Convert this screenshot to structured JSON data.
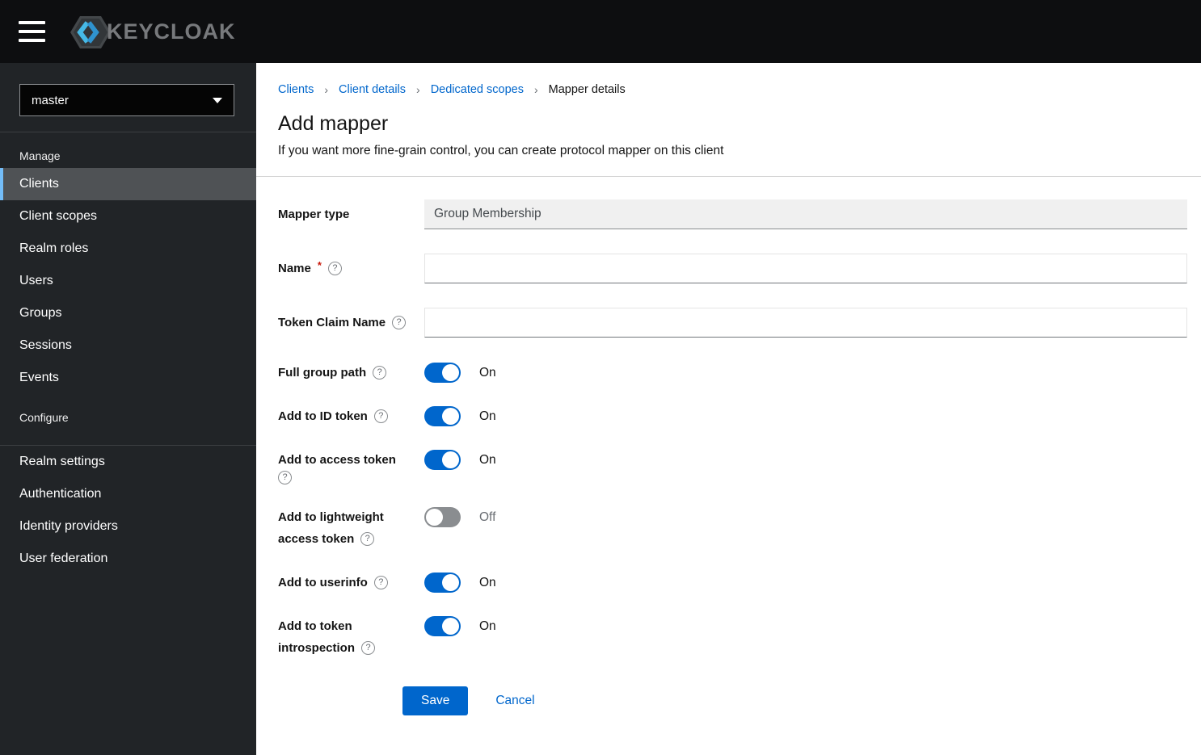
{
  "masthead": {
    "brand_text": "KEYCLOAK"
  },
  "sidebar": {
    "realm_selector": {
      "value": "master"
    },
    "sections": [
      {
        "label": "Manage",
        "divider_position": "above-label",
        "items": [
          {
            "label": "Clients",
            "selected": true
          },
          {
            "label": "Client scopes",
            "selected": false
          },
          {
            "label": "Realm roles",
            "selected": false
          },
          {
            "label": "Users",
            "selected": false
          },
          {
            "label": "Groups",
            "selected": false
          },
          {
            "label": "Sessions",
            "selected": false
          },
          {
            "label": "Events",
            "selected": false
          }
        ]
      },
      {
        "label": "Configure",
        "divider_position": "below-label",
        "items": [
          {
            "label": "Realm settings",
            "selected": false
          },
          {
            "label": "Authentication",
            "selected": false
          },
          {
            "label": "Identity providers",
            "selected": false
          },
          {
            "label": "User federation",
            "selected": false
          }
        ]
      }
    ]
  },
  "breadcrumb": {
    "separator": "›",
    "items": [
      {
        "label": "Clients",
        "link": true
      },
      {
        "label": "Client details",
        "link": true
      },
      {
        "label": "Dedicated scopes",
        "link": true
      },
      {
        "label": "Mapper details",
        "link": false
      }
    ]
  },
  "page": {
    "title": "Add mapper",
    "subtitle": "If you want more fine-grain control, you can create protocol mapper on this client"
  },
  "form": {
    "required_marker": "*",
    "help_icon_glyph": "?",
    "fields": [
      {
        "label": "Mapper type",
        "label_lines": [
          "Mapper type"
        ],
        "required": false,
        "help": false,
        "help_on_new_line": false,
        "control": {
          "type": "readonly",
          "value": "Group Membership"
        }
      },
      {
        "label": "Name",
        "label_lines": [
          "Name"
        ],
        "required": true,
        "help": true,
        "help_on_new_line": false,
        "control": {
          "type": "text",
          "value": "",
          "placeholder": ""
        }
      },
      {
        "label": "Token Claim Name",
        "label_lines": [
          "Token Claim Name"
        ],
        "required": false,
        "help": true,
        "help_on_new_line": false,
        "control": {
          "type": "text",
          "value": "",
          "placeholder": ""
        }
      },
      {
        "label": "Full group path",
        "label_lines": [
          "Full group path"
        ],
        "required": false,
        "help": true,
        "help_on_new_line": false,
        "control": {
          "type": "toggle",
          "on": true,
          "state_label": "On"
        }
      },
      {
        "label": "Add to ID token",
        "label_lines": [
          "Add to ID token"
        ],
        "required": false,
        "help": true,
        "help_on_new_line": false,
        "control": {
          "type": "toggle",
          "on": true,
          "state_label": "On"
        }
      },
      {
        "label": "Add to access token",
        "label_lines": [
          "Add to access token"
        ],
        "required": false,
        "help": true,
        "help_on_new_line": true,
        "control": {
          "type": "toggle",
          "on": true,
          "state_label": "On"
        }
      },
      {
        "label": "Add to lightweight access token",
        "label_lines": [
          "Add to lightweight",
          "access token"
        ],
        "required": false,
        "help": true,
        "help_on_new_line": false,
        "control": {
          "type": "toggle",
          "on": false,
          "state_label": "Off"
        }
      },
      {
        "label": "Add to userinfo",
        "label_lines": [
          "Add to userinfo"
        ],
        "required": false,
        "help": true,
        "help_on_new_line": false,
        "control": {
          "type": "toggle",
          "on": true,
          "state_label": "On"
        }
      },
      {
        "label": "Add to token introspection",
        "label_lines": [
          "Add to token",
          "introspection"
        ],
        "required": false,
        "help": true,
        "help_on_new_line": false,
        "control": {
          "type": "toggle",
          "on": true,
          "state_label": "On"
        }
      }
    ],
    "actions": {
      "save": "Save",
      "cancel": "Cancel"
    }
  },
  "colors": {
    "masthead_bg": "#0d0e10",
    "sidebar_bg": "#212427",
    "nav_selected_bg": "#4f5255",
    "nav_selected_border": "#73bcf7",
    "accent_primary": "#0066cc",
    "toggle_on": "#0066cc",
    "toggle_off": "#8a8d90",
    "link": "#0066cc",
    "required": "#c9190b",
    "divider": "#d2d2d2"
  }
}
